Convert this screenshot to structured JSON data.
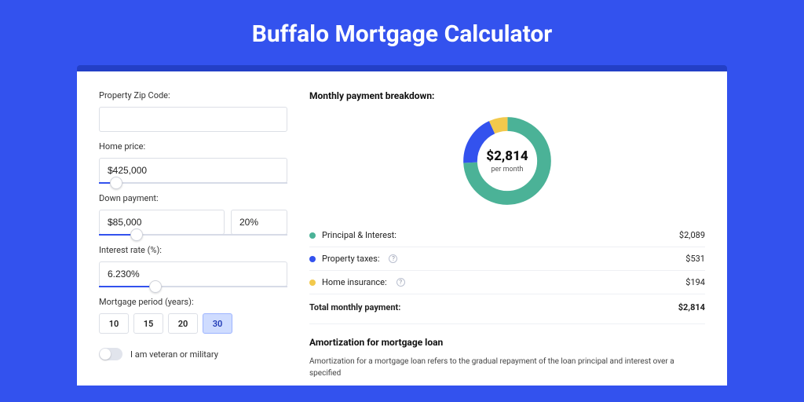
{
  "title": "Buffalo Mortgage Calculator",
  "form": {
    "zip": {
      "label": "Property Zip Code:",
      "value": ""
    },
    "home_price": {
      "label": "Home price:",
      "value": "$425,000",
      "slider_pct": 9
    },
    "down_payment": {
      "label": "Down payment:",
      "amount": "$85,000",
      "percent": "20%",
      "slider_pct": 20
    },
    "interest_rate": {
      "label": "Interest rate (%):",
      "value": "6.230%",
      "slider_pct": 30
    },
    "period": {
      "label": "Mortgage period (years):",
      "options": [
        "10",
        "15",
        "20",
        "30"
      ],
      "selected": "30"
    },
    "veteran": {
      "label": "I am veteran or military",
      "on": false
    }
  },
  "breakdown": {
    "title": "Monthly payment breakdown:",
    "center_amount": "$2,814",
    "center_sub": "per month",
    "items": [
      {
        "key": "pi",
        "label": "Principal & Interest:",
        "value": "$2,089",
        "color": "#4bb297",
        "has_help": false
      },
      {
        "key": "tax",
        "label": "Property taxes:",
        "value": "$531",
        "color": "#3352ee",
        "has_help": true
      },
      {
        "key": "ins",
        "label": "Home insurance:",
        "value": "$194",
        "color": "#f2c94c",
        "has_help": true
      }
    ],
    "total": {
      "label": "Total monthly payment:",
      "value": "$2,814"
    }
  },
  "chart_data": {
    "type": "pie",
    "title": "Monthly payment breakdown",
    "series": [
      {
        "name": "Principal & Interest",
        "value": 2089,
        "color": "#4bb297"
      },
      {
        "name": "Property taxes",
        "value": 531,
        "color": "#3352ee"
      },
      {
        "name": "Home insurance",
        "value": 194,
        "color": "#f2c94c"
      }
    ],
    "total": 2814,
    "center_label": "$2,814 per month"
  },
  "amortization": {
    "title": "Amortization for mortgage loan",
    "body": "Amortization for a mortgage loan refers to the gradual repayment of the loan principal and interest over a specified"
  }
}
